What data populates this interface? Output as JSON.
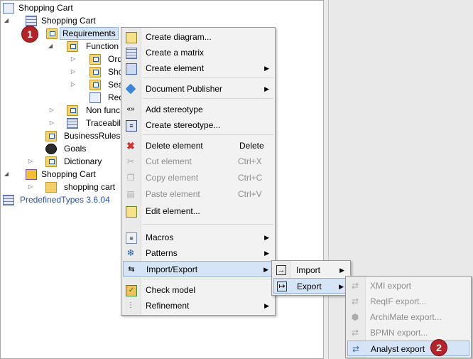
{
  "tree": {
    "root_label": "Shopping Cart",
    "shopping_cart_model": "Shopping Cart",
    "requirements": "Requirements",
    "functional": "Function",
    "child_ord": "Ord",
    "child_sho": "Sho",
    "child_sea": "Sea",
    "child_rec": "Red",
    "non_functional": "Non func",
    "traceability": "Traceabil",
    "business_rules": "BusinessRules",
    "goals": "Goals",
    "dictionary": "Dictionary",
    "shopping_cart_2": "Shopping Cart",
    "shopping_cart_folder": "shopping cart",
    "predefined_types": "PredefinedTypes 3.6.04"
  },
  "badges": {
    "first": "1",
    "second": "2"
  },
  "context_menu": {
    "create_diagram": "Create diagram...",
    "create_matrix": "Create a matrix",
    "create_element": "Create element",
    "document_publisher": "Document Publisher",
    "add_stereotype": "Add stereotype",
    "create_stereotype": "Create stereotype...",
    "delete_element": "Delete element",
    "delete_shortcut": "Delete",
    "cut_element": "Cut element",
    "cut_shortcut": "Ctrl+X",
    "copy_element": "Copy element",
    "copy_shortcut": "Ctrl+C",
    "paste_element": "Paste element",
    "paste_shortcut": "Ctrl+V",
    "edit_element": "Edit element...",
    "macros": "Macros",
    "patterns": "Patterns",
    "import_export": "Import/Export",
    "check_model": "Check model",
    "refinement": "Refinement"
  },
  "import_export_menu": {
    "import": "Import",
    "export": "Export"
  },
  "export_menu": {
    "xmi_export": "XMI export",
    "reqif_export": "ReqIF export...",
    "archimate_export": "ArchiMate export...",
    "bpmn_export": "BPMN export...",
    "analyst_export": "Analyst export"
  },
  "colors": {
    "badge": "#b4232a",
    "highlight": "#d5e4f6",
    "highlight_border": "#8fb3dd"
  }
}
